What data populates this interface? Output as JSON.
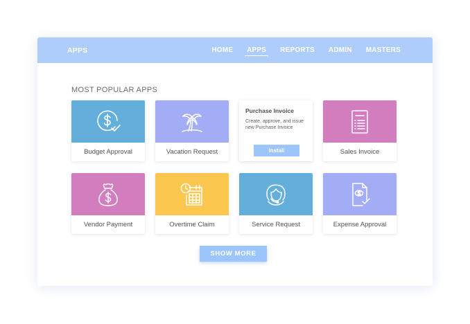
{
  "header": {
    "brand": "APPS",
    "nav": [
      "HOME",
      "APPS",
      "REPORTS",
      "ADMIN",
      "MASTERS"
    ],
    "active_nav": "APPS"
  },
  "main": {
    "section_title": "MOST POPULAR APPS",
    "apps": [
      {
        "label": "Budget Approval",
        "icon": "dollar-check-icon",
        "color": "#64aedc"
      },
      {
        "label": "Vacation Request",
        "icon": "palm-tree-icon",
        "color": "#a3adf6"
      },
      {
        "label": "Sales Invoice",
        "icon": "invoice-document-icon",
        "color": "#d27dbd"
      },
      {
        "label": "Vendor Payment",
        "icon": "money-bag-icon",
        "color": "#d27dbd"
      },
      {
        "label": "Overtime Claim",
        "icon": "calendar-clock-icon",
        "color": "#fbc74f"
      },
      {
        "label": "Service Request",
        "icon": "support-agent-icon",
        "color": "#64aedc"
      },
      {
        "label": "Expense Approval",
        "icon": "expense-document-icon",
        "color": "#a3adf6"
      }
    ],
    "featured": {
      "title": "Purchase Invoice",
      "description": "Create, approve, and issue new Purchase Invoice",
      "install_label": "Install"
    },
    "show_more_label": "SHOW  MORE"
  },
  "colors": {
    "header_bg": "#aecdfa",
    "button_bg": "#9cc6fb",
    "text_dark": "#4e525a"
  }
}
